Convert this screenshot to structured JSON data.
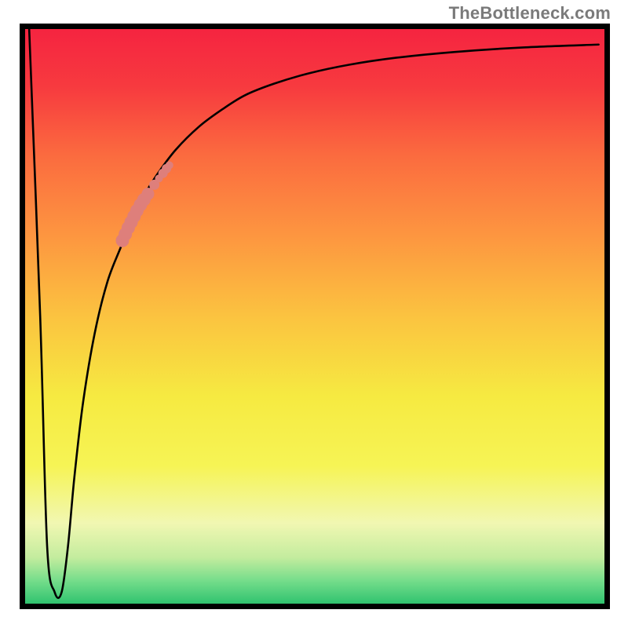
{
  "watermark": {
    "text": "TheBottleneck.com"
  },
  "gradient": {
    "stops": [
      {
        "offset": 0.0,
        "color": "#f52440"
      },
      {
        "offset": 0.1,
        "color": "#f73a3f"
      },
      {
        "offset": 0.22,
        "color": "#fb6b3f"
      },
      {
        "offset": 0.36,
        "color": "#fd9640"
      },
      {
        "offset": 0.5,
        "color": "#fbc340"
      },
      {
        "offset": 0.64,
        "color": "#f6ea41"
      },
      {
        "offset": 0.76,
        "color": "#f6f455"
      },
      {
        "offset": 0.86,
        "color": "#f1f7b2"
      },
      {
        "offset": 0.92,
        "color": "#c3ec9e"
      },
      {
        "offset": 0.96,
        "color": "#75dd8b"
      },
      {
        "offset": 1.0,
        "color": "#30c36f"
      }
    ]
  },
  "chart_data": {
    "type": "line",
    "title": "",
    "xlabel": "",
    "ylabel": "",
    "xlim": [
      0,
      100
    ],
    "ylim": [
      0,
      100
    ],
    "series": [
      {
        "name": "curve",
        "x": [
          0.7,
          2.6,
          3.8,
          5.1,
          6.3,
          7.4,
          8.5,
          10.0,
          12.0,
          14.2,
          16.5,
          18.5,
          20.5,
          23.0,
          26.0,
          30.0,
          34.0,
          38.0,
          43.0,
          49.0,
          56.0,
          64.0,
          74.0,
          86.0,
          99.0
        ],
        "values": [
          100,
          50,
          10,
          2,
          2,
          10,
          22,
          35,
          47,
          56,
          62,
          67,
          71,
          75,
          79,
          83,
          86,
          88.5,
          90.5,
          92.3,
          93.8,
          95.0,
          96.0,
          96.8,
          97.3
        ]
      }
    ],
    "markers": {
      "name": "highlight-scatter",
      "color": "#de7f7b",
      "points": [
        {
          "x": 16.8,
          "y": 63.2,
          "r": 8.5
        },
        {
          "x": 17.3,
          "y": 64.3,
          "r": 8.5
        },
        {
          "x": 17.8,
          "y": 65.4,
          "r": 8.5
        },
        {
          "x": 18.3,
          "y": 66.4,
          "r": 8.5
        },
        {
          "x": 18.8,
          "y": 67.4,
          "r": 8.5
        },
        {
          "x": 19.3,
          "y": 68.4,
          "r": 8.5
        },
        {
          "x": 19.9,
          "y": 69.4,
          "r": 8.5
        },
        {
          "x": 20.5,
          "y": 70.3,
          "r": 8.5
        },
        {
          "x": 21.2,
          "y": 71.3,
          "r": 8.0
        },
        {
          "x": 22.3,
          "y": 72.9,
          "r": 6.5
        },
        {
          "x": 23.1,
          "y": 74.0,
          "r": 5.0
        },
        {
          "x": 23.8,
          "y": 74.9,
          "r": 6.0
        },
        {
          "x": 24.4,
          "y": 75.7,
          "r": 6.0
        },
        {
          "x": 24.9,
          "y": 76.3,
          "r": 5.0
        }
      ]
    }
  }
}
